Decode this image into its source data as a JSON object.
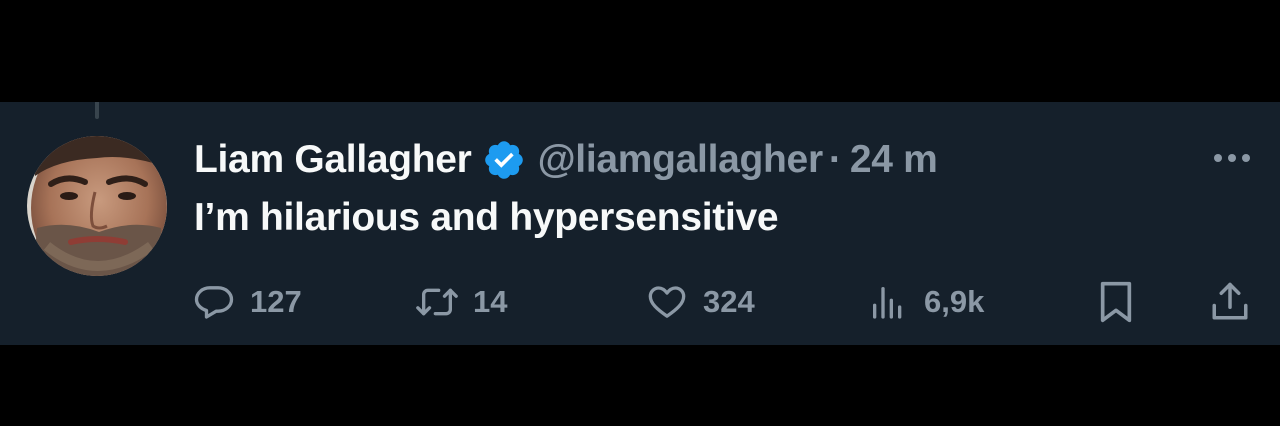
{
  "tweet": {
    "display_name": "Liam Gallagher",
    "verified": true,
    "handle": "@liamgallagher",
    "separator": "·",
    "time": "24 m",
    "text": "I’m hilarious and hypersensitive"
  },
  "actions": {
    "replies": "127",
    "retweets": "14",
    "likes": "324",
    "views": "6,9k"
  },
  "icons": {
    "avatar": "avatar-photo",
    "verified": "verified-badge-icon",
    "more": "more-options-icon",
    "reply": "reply-icon",
    "retweet": "retweet-icon",
    "like": "heart-icon",
    "views": "views-chart-icon",
    "bookmark": "bookmark-icon",
    "share": "share-icon"
  },
  "colors": {
    "background": "#15202b",
    "outer": "#000000",
    "text_primary": "#f7f9f9",
    "text_secondary": "#8b98a5",
    "verified_blue": "#1d9bf0"
  }
}
